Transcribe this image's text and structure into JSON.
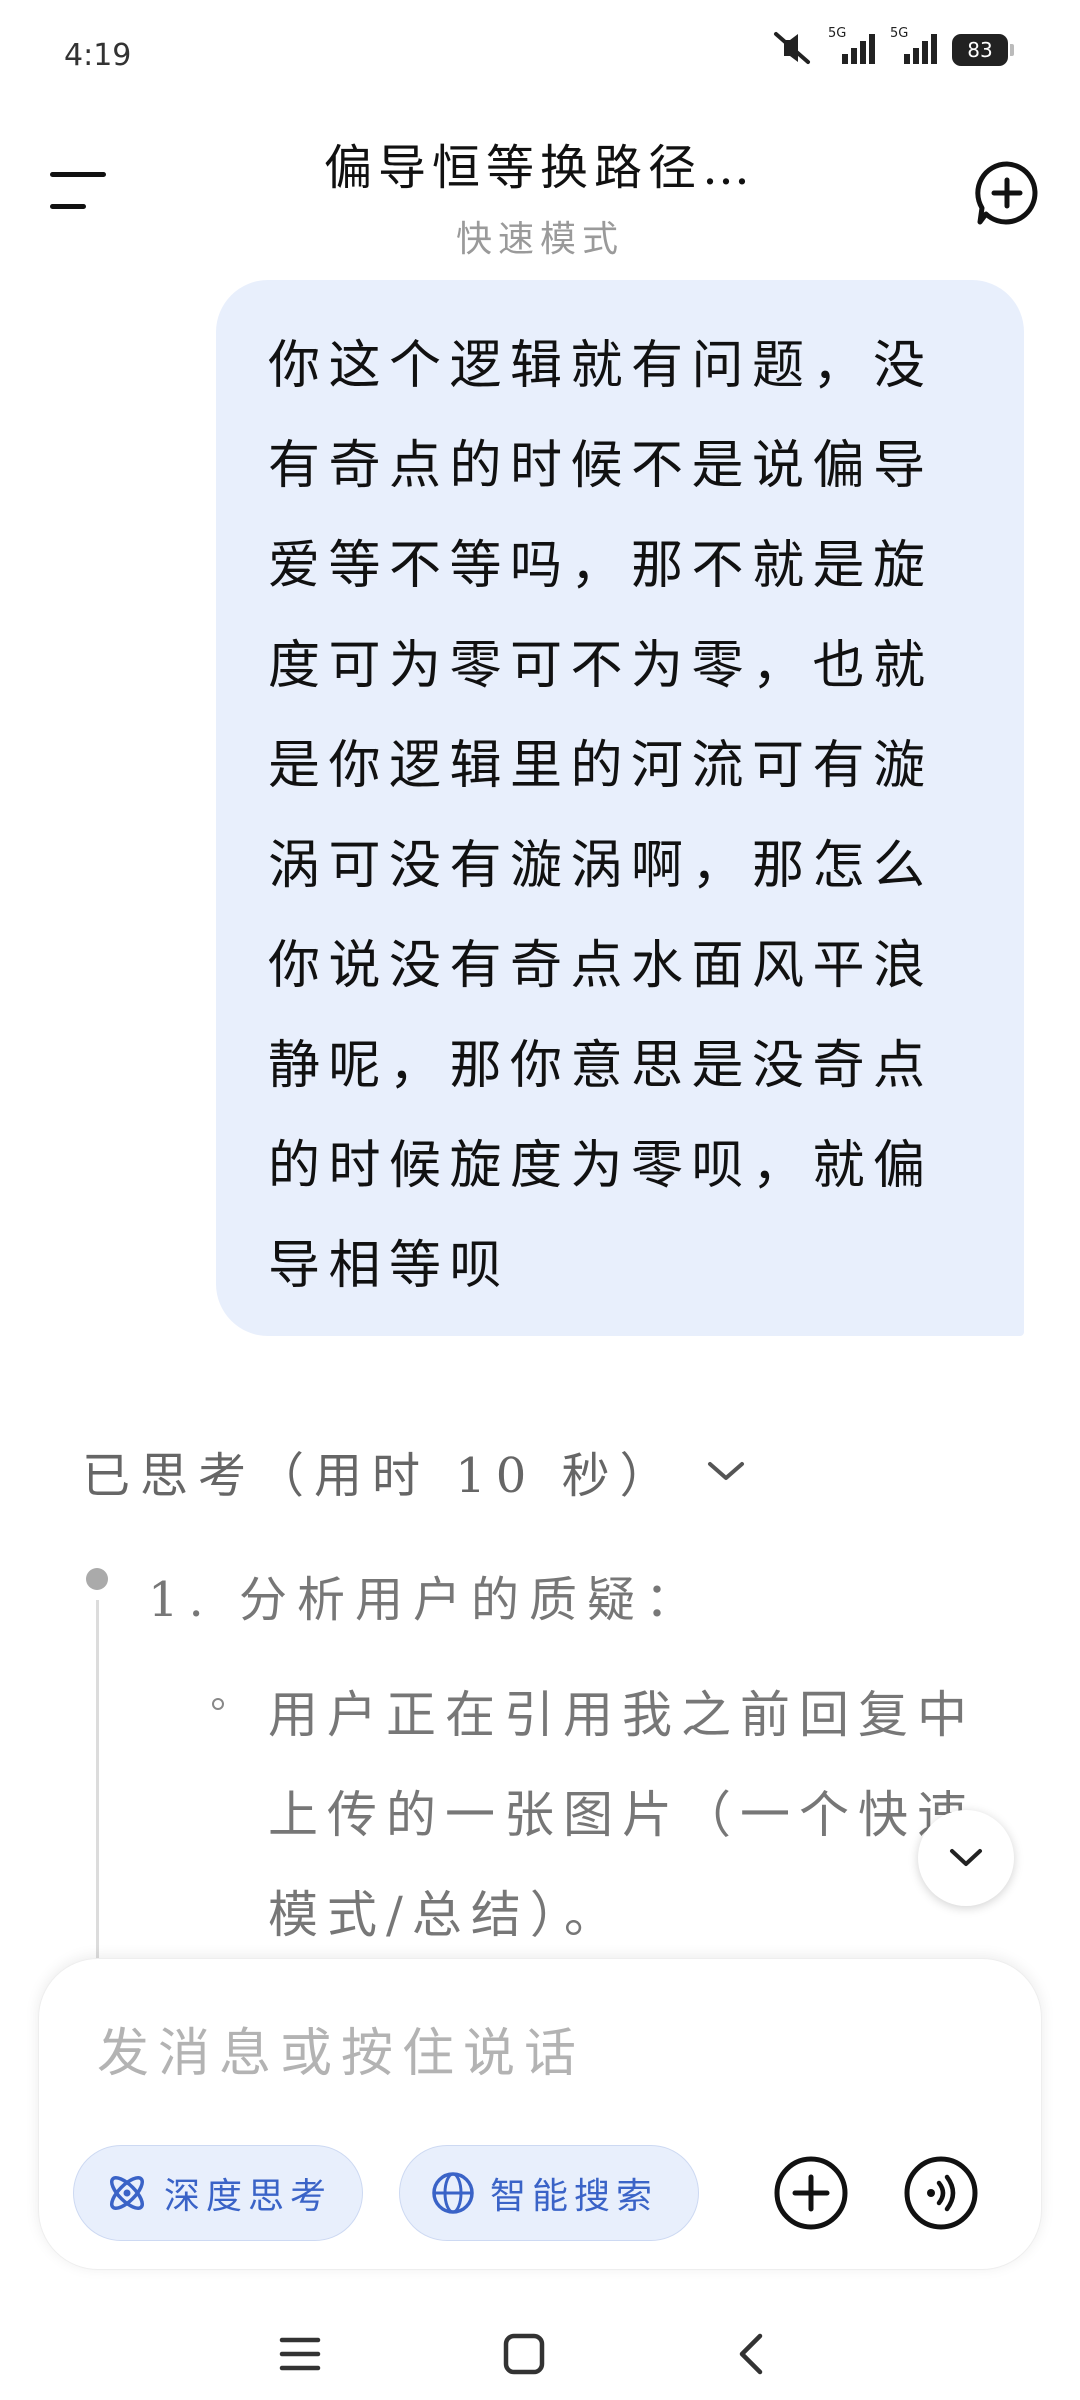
{
  "status_bar": {
    "time": "4:19",
    "battery": "83",
    "signal_1": "5G",
    "signal_2": "5G"
  },
  "header": {
    "title": "偏导恒等换路径…",
    "subtitle": "快速模式"
  },
  "user_message": {
    "text": "你这个逻辑就有问题，没有奇点的时候不是说偏导爱等不等吗，那不就是旋度可为零可不为零，也就是你逻辑里的河流可有漩涡可没有漩涡啊，那怎么你说没有奇点水面风平浪静呢，那你意思是没奇点的时候旋度为零呗，就偏导相等呗"
  },
  "thinking": {
    "label": "已思考（用时 10 秒）",
    "step_title": "1. 分析用户的质疑：",
    "sub_item": "用户正在引用我之前回复中上传的一张图片（一个快速模式/总结）。"
  },
  "composer": {
    "placeholder": "发消息或按住说话",
    "deep_think_label": "深度思考",
    "smart_search_label": "智能搜索"
  },
  "colors": {
    "bubble_bg": "#e8effc",
    "accent": "#3a63c7"
  },
  "icons": {
    "menu": "menu-icon",
    "new_chat": "new-chat-icon",
    "chevron": "chevron-down-icon",
    "deep_think": "atom-icon",
    "search": "globe-icon",
    "plus": "plus-icon",
    "voice": "voice-icon",
    "nav_menu": "nav-menu-icon",
    "nav_home": "nav-home-icon",
    "nav_back": "nav-back-icon"
  }
}
